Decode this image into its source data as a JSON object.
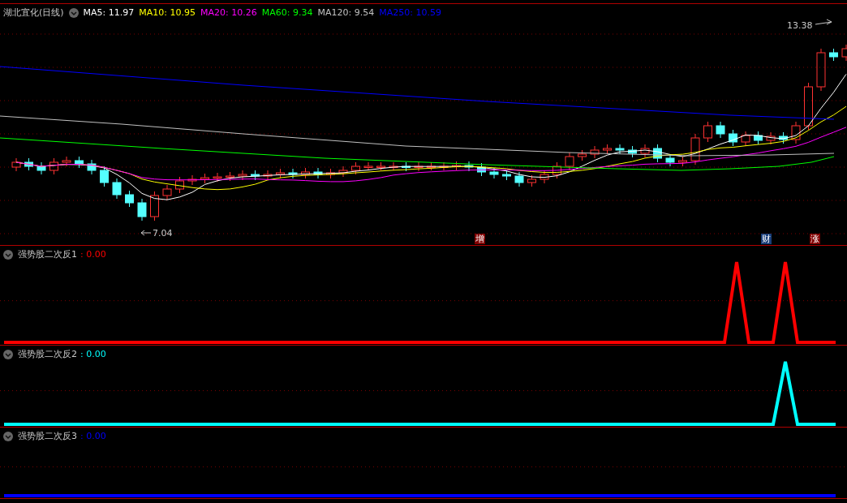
{
  "main_chart": {
    "title": "湖北宜化(日线)",
    "moving_averages": [
      {
        "label": "MA5:",
        "value": "11.97",
        "color": "#ffffff"
      },
      {
        "label": "MA10:",
        "value": "10.95",
        "color": "#ffff00"
      },
      {
        "label": "MA20:",
        "value": "10.26",
        "color": "#ff00ff"
      },
      {
        "label": "MA60:",
        "value": "9.34",
        "color": "#00ff00"
      },
      {
        "label": "MA120:",
        "value": "9.54",
        "color": "#c0c0c0"
      },
      {
        "label": "MA250:",
        "value": "10.59",
        "color": "#0000ff"
      }
    ],
    "high_label": "13.38",
    "low_label": "7.04",
    "markers": [
      {
        "text": "增",
        "color": "#800000"
      },
      {
        "text": "财",
        "color": "#1a3f7a"
      },
      {
        "text": "涨",
        "color": "#800000"
      }
    ]
  },
  "indicators": [
    {
      "name": "强势股二次反1",
      "value": ": 0.00",
      "color": "#ff0000"
    },
    {
      "name": "强势股二次反2",
      "value": ": 0.00",
      "color": "#00ffff"
    },
    {
      "name": "强势股二次反3",
      "value": ": 0.00",
      "color": "#0000ff"
    }
  ]
}
